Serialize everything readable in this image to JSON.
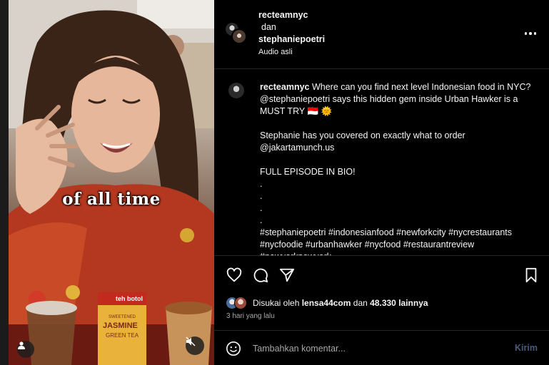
{
  "header": {
    "user1": "recteamnyc",
    "connector": "dan",
    "user2": "stephaniepoetri",
    "audio_label": "Audio asli"
  },
  "video": {
    "caption": "of all time",
    "product_brand": "teh botol",
    "product_label_1": "JASMINE",
    "product_label_2": "GREEN TEA",
    "product_label_small": "SWEETENED"
  },
  "post": {
    "username": "recteamnyc",
    "line1": "Where can you find next level Indonesian food in NYC? @stephaniepoetri says this hidden gem inside Urban Hawker is a MUST TRY 🇮🇩 🌞",
    "line2": "Stephanie has you covered on exactly what to order @jakartamunch.us",
    "line3": "FULL EPISODE IN BIO!",
    "dots": [
      ".",
      ".",
      ".",
      "."
    ],
    "hashtags": "#stephaniepoetri #indonesianfood #newforkcity #nycrestaurants #nycfoodie #urbanhawker #nycfood #restaurantreview #newyorknewyork"
  },
  "likes": {
    "prefix": "Disukai oleh",
    "liker": "lensa44com",
    "connector": "dan",
    "count": "48.330 lainnya"
  },
  "time_ago": "3 hari yang lalu",
  "comment_box": {
    "placeholder": "Tambahkan komentar...",
    "post_label": "Kirim"
  },
  "icons": {
    "more": "more-horizontal-icon",
    "like": "heart-icon",
    "comment": "comment-icon",
    "share": "send-icon",
    "save": "bookmark-icon",
    "emoji": "emoji-icon",
    "tag": "user-tag-icon",
    "mute": "muted-speaker-icon"
  },
  "colors": {
    "background": "#000000",
    "text": "#f5f5f5",
    "muted_text": "#a8a8a8",
    "post_button": "#4a5a80",
    "divider": "#262626"
  }
}
